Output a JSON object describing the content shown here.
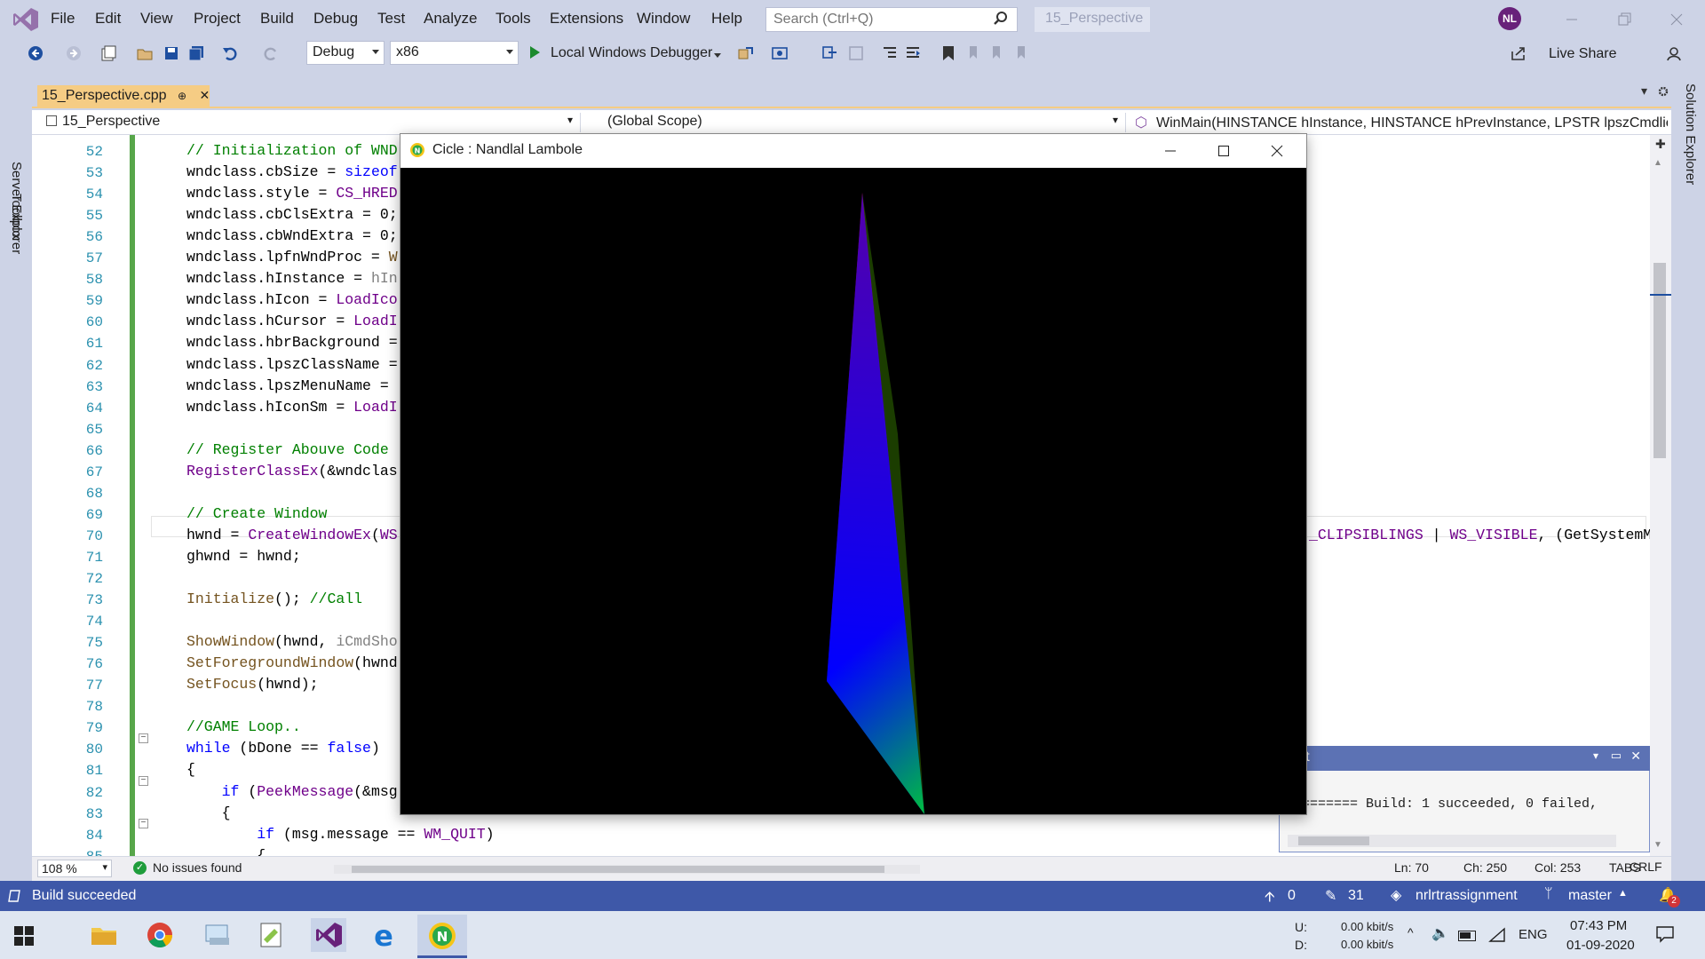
{
  "menu": [
    "File",
    "Edit",
    "View",
    "Project",
    "Build",
    "Debug",
    "Test",
    "Analyze",
    "Tools",
    "Extensions",
    "Window",
    "Help"
  ],
  "search": {
    "placeholder": "Search (Ctrl+Q)",
    "value": ""
  },
  "solution_name": "15_Perspective",
  "user_initials": "NL",
  "toolbar": {
    "configuration": "Debug",
    "platform": "x86",
    "debugger_label": "Local Windows Debugger",
    "live_share": "Live Share"
  },
  "side_tools": {
    "left": [
      "Server Explorer",
      "Toolbox"
    ],
    "right": [
      "Solution Explorer"
    ]
  },
  "document_tab": {
    "label": "15_Perspective.cpp",
    "pin": "⊕",
    "close": "✕"
  },
  "navbar": {
    "project": "15_Perspective",
    "scope": "(Global Scope)",
    "member": "WinMain(HINSTANCE hInstance, HINSTANCE hPrevInstance, LPSTR lpszCmdlie, ir"
  },
  "code": {
    "line_numbers": [
      "52",
      "53",
      "54",
      "55",
      "56",
      "57",
      "58",
      "59",
      "60",
      "61",
      "62",
      "63",
      "64",
      "65",
      "66",
      "67",
      "68",
      "69",
      "70",
      "71",
      "72",
      "73",
      "74",
      "75",
      "76",
      "77",
      "78",
      "79",
      "80",
      "81",
      "82",
      "83",
      "84",
      "85"
    ],
    "lines": [
      [
        {
          "t": "// Initialization of WND",
          "c": "cm"
        }
      ],
      [
        {
          "t": "wndclass.cbSize = "
        },
        {
          "t": "sizeof",
          "c": "kw"
        }
      ],
      [
        {
          "t": "wndclass.style = "
        },
        {
          "t": "CS_HRED",
          "c": "mac"
        }
      ],
      [
        {
          "t": "wndclass.cbClsExtra = 0;"
        }
      ],
      [
        {
          "t": "wndclass.cbWndExtra = 0;"
        }
      ],
      [
        {
          "t": "wndclass.lpfnWndProc = "
        },
        {
          "t": "W",
          "c": "fn"
        }
      ],
      [
        {
          "t": "wndclass.hInstance = "
        },
        {
          "t": "hIn",
          "c": "prm"
        }
      ],
      [
        {
          "t": "wndclass.hIcon = "
        },
        {
          "t": "LoadIco",
          "c": "mac"
        }
      ],
      [
        {
          "t": "wndclass.hCursor = "
        },
        {
          "t": "LoadI",
          "c": "mac"
        }
      ],
      [
        {
          "t": "wndclass.hbrBackground ="
        }
      ],
      [
        {
          "t": "wndclass.lpszClassName ="
        }
      ],
      [
        {
          "t": "wndclass.lpszMenuName ="
        }
      ],
      [
        {
          "t": "wndclass.hIconSm = "
        },
        {
          "t": "LoadI",
          "c": "mac"
        }
      ],
      [
        {
          "t": ""
        }
      ],
      [
        {
          "t": "// Register Abouve Code",
          "c": "cm"
        }
      ],
      [
        {
          "t": "RegisterClassEx",
          "c": "mac"
        },
        {
          "t": "(&wndclas"
        }
      ],
      [
        {
          "t": ""
        }
      ],
      [
        {
          "t": "// Create Window",
          "c": "cm"
        }
      ],
      [
        {
          "t": "hwnd = "
        },
        {
          "t": "CreateWindowEx",
          "c": "mac"
        },
        {
          "t": "("
        },
        {
          "t": "WS",
          "c": "mac"
        }
      ],
      [
        {
          "t": "ghwnd = hwnd;"
        }
      ],
      [
        {
          "t": ""
        }
      ],
      [
        {
          "t": "Initialize",
          "c": "fn"
        },
        {
          "t": "(); "
        },
        {
          "t": "//Call",
          "c": "cm"
        }
      ],
      [
        {
          "t": ""
        }
      ],
      [
        {
          "t": "ShowWindow",
          "c": "fn"
        },
        {
          "t": "(hwnd, "
        },
        {
          "t": "iCmdSho",
          "c": "prm"
        }
      ],
      [
        {
          "t": "SetForegroundWindow",
          "c": "fn"
        },
        {
          "t": "(hwnd"
        }
      ],
      [
        {
          "t": "SetFocus",
          "c": "fn"
        },
        {
          "t": "(hwnd);"
        }
      ],
      [
        {
          "t": ""
        }
      ],
      [
        {
          "t": "//GAME Loop..",
          "c": "cm"
        }
      ],
      [
        {
          "t": "while",
          "c": "kw"
        },
        {
          "t": " (bDone == "
        },
        {
          "t": "false",
          "c": "kw"
        },
        {
          "t": ")"
        }
      ],
      [
        {
          "t": "{"
        }
      ],
      [
        {
          "t": "    "
        },
        {
          "t": "if",
          "c": "kw"
        },
        {
          "t": " ("
        },
        {
          "t": "PeekMessage",
          "c": "mac"
        },
        {
          "t": "(&msg"
        }
      ],
      [
        {
          "t": "    {"
        }
      ],
      [
        {
          "t": "        "
        },
        {
          "t": "if",
          "c": "kw"
        },
        {
          "t": " (msg.message == "
        },
        {
          "t": "WM_QUIT",
          "c": "mac"
        },
        {
          "t": ")"
        }
      ],
      [
        {
          "t": "        {"
        }
      ]
    ],
    "line70_tail": [
      {
        "t": "_CLIPSIBLINGS",
        "c": "mac"
      },
      {
        "t": " | "
      },
      {
        "t": "WS_VISIBLE",
        "c": "mac"
      },
      {
        "t": ", (GetSystemM"
      }
    ]
  },
  "output_panel": {
    "title": "tput",
    "text": "========= Build: 1 succeeded, 0 failed,"
  },
  "app_window": {
    "title": "Cicle : Nandlal Lambole"
  },
  "render": {
    "vertex_colors": [
      "#ff0000",
      "#0000ff",
      "#00ff00"
    ]
  },
  "editor_status": {
    "zoom": "108 %",
    "issues": "No issues found",
    "ln": "Ln: 70",
    "ch": "Ch: 250",
    "col": "Col: 253",
    "tabs": "TABS",
    "eol": "CRLF"
  },
  "vs_status": {
    "build": "Build succeeded",
    "push_count": "0",
    "changes_count": "31",
    "repo": "nrlrtrassignment",
    "branch": "master",
    "notifications": "2"
  },
  "tray": {
    "net_u_label": "U:",
    "net_d_label": "D:",
    "net_u": "0.00 kbit/s",
    "net_d": "0.00 kbit/s",
    "lang": "ENG",
    "time": "07:43 PM",
    "date": "01-09-2020"
  }
}
